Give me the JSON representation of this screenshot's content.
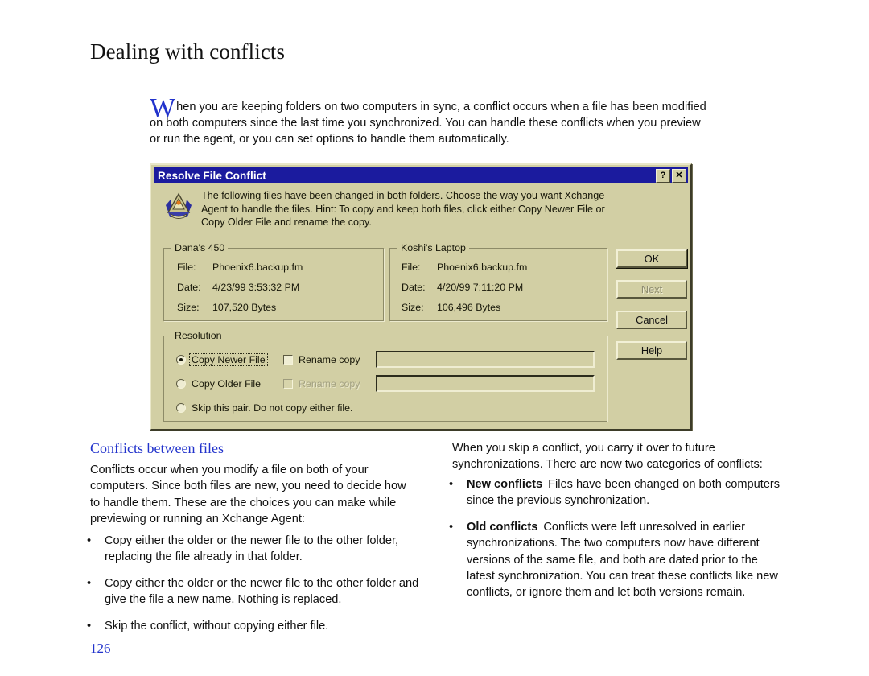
{
  "document": {
    "chapter_title": "Dealing with conflicts",
    "page_number": "126",
    "intro_dropcap": "W",
    "intro_text": "hen you are keeping folders on two computers in sync, a conflict occurs when a file has been modified on both computers since the last time you synchronized. You can handle these conflicts when you preview or run the agent, or you can set options to handle them automatically."
  },
  "dialog": {
    "title": "Resolve File Conflict",
    "titlebar_buttons": [
      {
        "name": "help-button",
        "glyph": "?"
      },
      {
        "name": "close-button",
        "glyph": "✕"
      }
    ],
    "message": "The following files have been changed in both folders.  Choose the way you want Xchange\nAgent to handle the files.  Hint: To copy and keep both files, click either Copy Newer File or\nCopy Older File and rename the copy.",
    "left_panel": {
      "legend": "Dana's 450",
      "rows": [
        {
          "label": "File:",
          "value": "Phoenix6.backup.fm"
        },
        {
          "label": "Date:",
          "value": "4/23/99 3:53:32 PM"
        },
        {
          "label": "Size:",
          "value": "107,520 Bytes"
        }
      ]
    },
    "right_panel": {
      "legend": "Koshi's Laptop",
      "rows": [
        {
          "label": "File:",
          "value": "Phoenix6.backup.fm"
        },
        {
          "label": "Date:",
          "value": "4/20/99 7:11:20 PM"
        },
        {
          "label": "Size:",
          "value": "106,496 Bytes"
        }
      ]
    },
    "resolution": {
      "legend": "Resolution",
      "options": [
        {
          "label": "Copy Newer File",
          "selected": true
        },
        {
          "label": "Copy Older File",
          "selected": false
        },
        {
          "label": "Skip this pair. Do not copy either file.",
          "selected": false
        }
      ],
      "rename_row1": {
        "label": "Rename copy",
        "checked": false,
        "enabled": true,
        "value": ""
      },
      "rename_row2": {
        "label": "Rename copy",
        "checked": false,
        "enabled": false,
        "value": ""
      }
    },
    "buttons": [
      {
        "label": "OK",
        "state": "default"
      },
      {
        "label": "Next",
        "state": "disabled"
      },
      {
        "label": "Cancel",
        "state": "normal"
      },
      {
        "label": "Help",
        "state": "normal"
      }
    ],
    "colors": {
      "face": "#d2cfa4",
      "titlebar": "#1b1b9e",
      "titlebar_text": "#ffffff"
    }
  },
  "body": {
    "left_column": {
      "heading": "Conflicts between files",
      "paragraph": "Conflicts occur when you modify a file on both of your computers. Since both files are new, you need to decide how to handle them. These are the choices you can make while previewing or running an Xchange Agent:",
      "bullets": [
        "Copy either the older or the newer file to the other folder, replacing the file already in that folder.",
        "Copy either the older or the newer file to the other folder and give the file a new name. Nothing is replaced.",
        "Skip the conflict, without copying either file."
      ]
    },
    "right_column": {
      "paragraph": "When you skip a conflict, you carry it over to future synchronizations. There are now two categories of conflicts:",
      "bullets": [
        {
          "lead": "New conflicts",
          "text": "Files have been changed on both computers since the previous synchronization."
        },
        {
          "lead": "Old conflicts",
          "text": "Conflicts were left unresolved in earlier synchronizations. The two computers now have different versions of the same file, and both are dated prior to the latest synchronization. You can treat these conflicts like new conflicts, or ignore them and let both versions remain."
        }
      ]
    }
  },
  "bullet_glyph": "•"
}
